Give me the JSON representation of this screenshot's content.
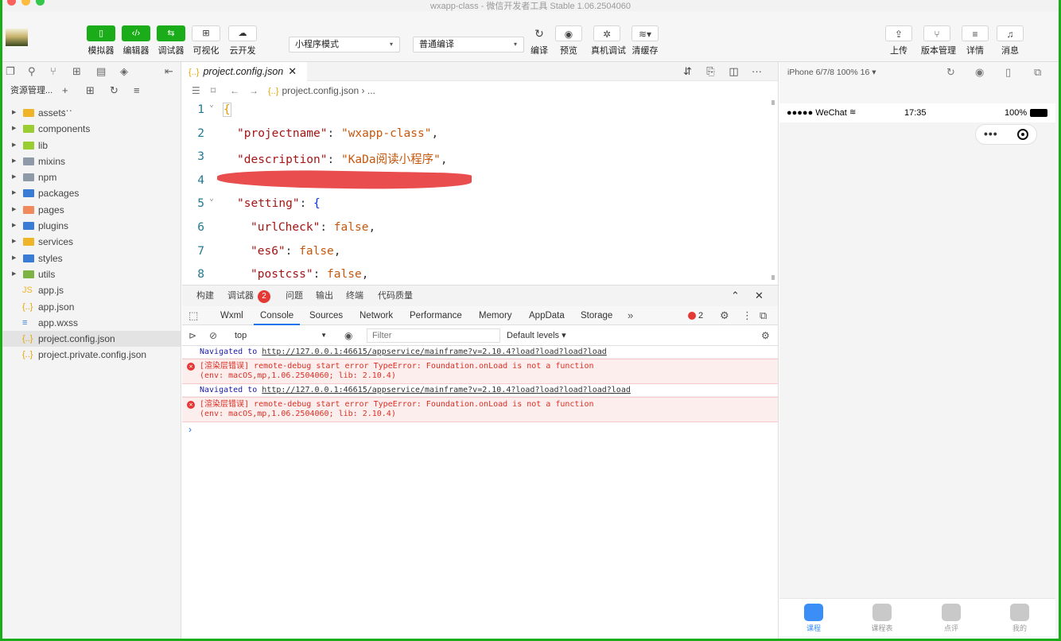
{
  "window": {
    "title": "wxapp-class - 微信开发者工具 Stable 1.06.2504060"
  },
  "toolbar": {
    "simulator": "模拟器",
    "editor": "编辑器",
    "debugger": "调试器",
    "visual": "可视化",
    "cloud": "云开发",
    "mode_select": "小程序模式",
    "compile_select": "普通编译",
    "compile": "编译",
    "preview": "预览",
    "real_debug": "真机调试",
    "clear_cache": "清缓存",
    "upload": "上传",
    "version": "版本管理",
    "details": "详情",
    "messages": "消息"
  },
  "explorer": {
    "title": "资源管理...",
    "items": [
      {
        "label": "assets",
        "kind": "folder",
        "color": "#f0b429"
      },
      {
        "label": "components",
        "kind": "folder",
        "color": "#9acd32"
      },
      {
        "label": "lib",
        "kind": "folder",
        "color": "#9acd32"
      },
      {
        "label": "mixins",
        "kind": "folder",
        "color": "#8f9aa8"
      },
      {
        "label": "npm",
        "kind": "folder",
        "color": "#8f9aa8"
      },
      {
        "label": "packages",
        "kind": "folder",
        "color": "#3a7bd5"
      },
      {
        "label": "pages",
        "kind": "folder",
        "color": "#f08a5d"
      },
      {
        "label": "plugins",
        "kind": "folder",
        "color": "#3a7bd5"
      },
      {
        "label": "services",
        "kind": "folder",
        "color": "#f0b429"
      },
      {
        "label": "styles",
        "kind": "folder",
        "color": "#3a7bd5"
      },
      {
        "label": "utils",
        "kind": "folder",
        "color": "#7cb342"
      },
      {
        "label": "app.js",
        "kind": "js",
        "color": "#f0b429"
      },
      {
        "label": "app.json",
        "kind": "json",
        "color": "#e6a400"
      },
      {
        "label": "app.wxss",
        "kind": "wxss",
        "color": "#3a7bd5"
      },
      {
        "label": "project.config.json",
        "kind": "json",
        "color": "#e6a400"
      },
      {
        "label": "project.private.config.json",
        "kind": "json",
        "color": "#e6a400"
      }
    ]
  },
  "editor": {
    "tab_label": "project.config.json",
    "breadcrumb_file": "project.config.json",
    "breadcrumb_more": "...",
    "lines": [
      {
        "num": "1"
      },
      {
        "num": "2",
        "key": "\"projectname\"",
        "val": "\"wxapp-class\""
      },
      {
        "num": "3",
        "key": "\"description\"",
        "val": "\"KaDa阅读小程序\""
      },
      {
        "num": "4"
      },
      {
        "num": "5",
        "key": "\"setting\""
      },
      {
        "num": "6",
        "key": "\"urlCheck\"",
        "val": "false"
      },
      {
        "num": "7",
        "key": "\"es6\"",
        "val": "false"
      },
      {
        "num": "8",
        "key": "\"postcss\"",
        "val": "false"
      }
    ]
  },
  "devtools": {
    "tabs": {
      "build": "构建",
      "debugger": "调试器",
      "debugger_badge": "2",
      "issues": "问题",
      "output": "输出",
      "terminal": "终端",
      "quality": "代码质量"
    },
    "panels": [
      "Wxml",
      "Console",
      "Sources",
      "Network",
      "Performance",
      "Memory",
      "AppData",
      "Storage"
    ],
    "error_count": "2",
    "context": "top",
    "filter_placeholder": "Filter",
    "levels": "Default levels ▾",
    "logs": [
      {
        "type": "nav",
        "prefix": "Navigated to",
        "url": "http://127.0.0.1:46615/appservice/mainframe?v=2.10.4?load?load?load?load"
      },
      {
        "type": "err",
        "line1": "[渲染层错误] remote-debug start error TypeError: Foundation.onLoad is not a function",
        "line2": "(env: macOS,mp,1.06.2504060; lib: 2.10.4)"
      },
      {
        "type": "nav",
        "prefix": "Navigated to",
        "url": "http://127.0.0.1:46615/appservice/mainframe?v=2.10.4?load?load?load?load?load"
      },
      {
        "type": "err",
        "line1": "[渲染层错误] remote-debug start error TypeError: Foundation.onLoad is not a function",
        "line2": "(env: macOS,mp,1.06.2504060; lib: 2.10.4)"
      }
    ]
  },
  "simulator": {
    "device": "iPhone 6/7/8 100% 16 ▾",
    "carrier": "●●●●● WeChat",
    "time": "17:35",
    "battery": "100%",
    "tabbar": [
      "课程",
      "课程表",
      "点评",
      "我的"
    ]
  }
}
